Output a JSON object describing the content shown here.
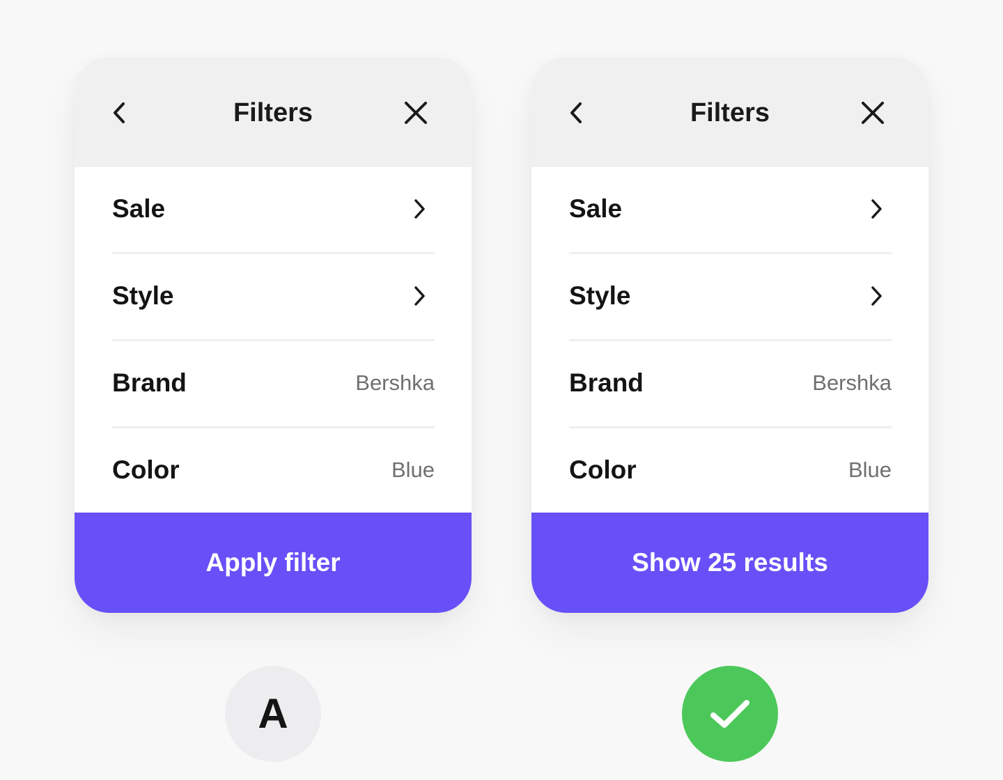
{
  "colors": {
    "background": "#f8f8f8",
    "header_bg": "#f0f0f0",
    "accent": "#6750f7",
    "success": "#4cc85a",
    "badge_neutral": "#ededef",
    "value_text": "#6f6f6f"
  },
  "panels": [
    {
      "header": {
        "title": "Filters",
        "back_icon": "chevron-left-icon",
        "close_icon": "close-icon"
      },
      "rows": [
        {
          "label": "Sale",
          "value": "",
          "icon": "chevron-right-icon"
        },
        {
          "label": "Style",
          "value": "",
          "icon": "chevron-right-icon"
        },
        {
          "label": "Brand",
          "value": "Bershka"
        },
        {
          "label": "Color",
          "value": "Blue"
        }
      ],
      "cta_label": "Apply filter"
    },
    {
      "header": {
        "title": "Filters",
        "back_icon": "chevron-left-icon",
        "close_icon": "close-icon"
      },
      "rows": [
        {
          "label": "Sale",
          "value": "",
          "icon": "chevron-right-icon"
        },
        {
          "label": "Style",
          "value": "",
          "icon": "chevron-right-icon"
        },
        {
          "label": "Brand",
          "value": "Bershka"
        },
        {
          "label": "Color",
          "value": "Blue"
        }
      ],
      "cta_label": "Show 25 results"
    }
  ],
  "badges": {
    "option_a_label": "A",
    "option_b_icon": "checkmark-icon"
  }
}
